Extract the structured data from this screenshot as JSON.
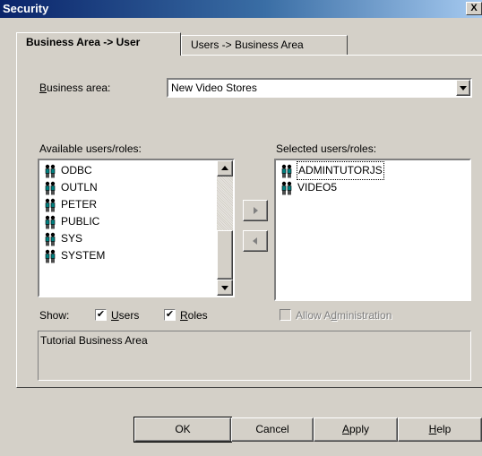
{
  "window": {
    "title": "Security",
    "close_label": "X"
  },
  "tabs": [
    {
      "label": "Business Area -> User",
      "active": true
    },
    {
      "label": "Users -> Business Area",
      "active": false
    }
  ],
  "business_area": {
    "label_prefix": "B",
    "label_rest": "usiness area:",
    "value": "New Video Stores"
  },
  "available": {
    "label": "Available users/roles:",
    "items": [
      "ODBC",
      "OUTLN",
      "PETER",
      "PUBLIC",
      "SYS",
      "SYSTEM"
    ],
    "item_icon": "user-group-icon"
  },
  "selected": {
    "label": "Selected users/roles:",
    "items": [
      "ADMINTUTORJS",
      "VIDEO5"
    ],
    "focused_index": 0
  },
  "show": {
    "label": "Show:",
    "users": {
      "prefix": "U",
      "rest": "sers",
      "checked": true
    },
    "roles": {
      "prefix": "R",
      "rest": "oles",
      "checked": true
    }
  },
  "allow_admin": {
    "pre": "Allow A",
    "u": "d",
    "post": "ministration",
    "checked": false,
    "enabled": false
  },
  "description": "Tutorial Business Area",
  "buttons": {
    "ok": "OK",
    "cancel": "Cancel",
    "apply_u": "A",
    "apply_rest": "pply",
    "help_u": "H",
    "help_rest": "elp"
  },
  "colors": {
    "title_start": "#0a246a",
    "title_end": "#a6caf0",
    "face": "#d4d0c8"
  }
}
